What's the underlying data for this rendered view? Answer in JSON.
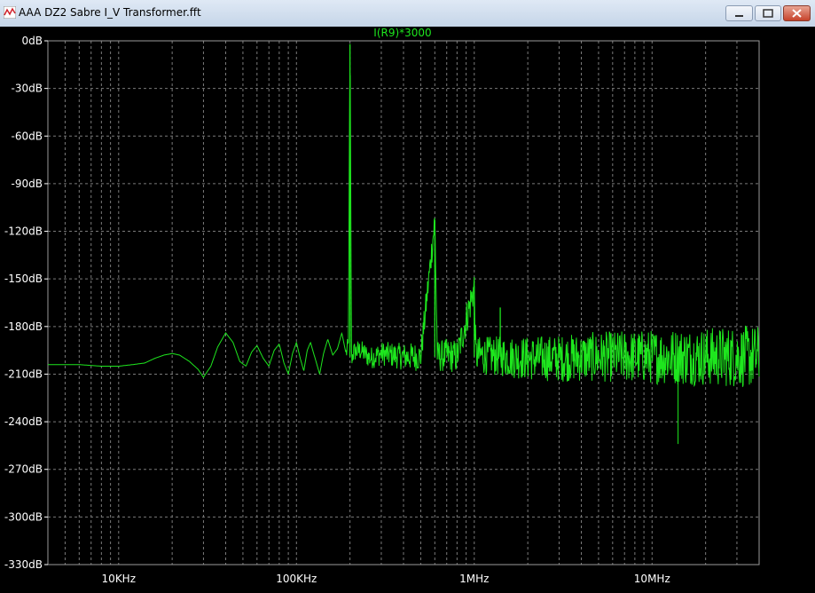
{
  "window": {
    "title": "AAA DZ2 Sabre I_V Transformer.fft",
    "icon": "waveform-icon",
    "controls": [
      "minimize-icon",
      "maximize-icon",
      "close-icon"
    ]
  },
  "colors": {
    "background": "#000000",
    "grid": "#7a7a7a",
    "trace": "#1ee61e",
    "axis_text": "#ffffff",
    "titlebar": "#c5d5e8"
  },
  "chart_data": {
    "type": "line",
    "title": "I(R9)*3000",
    "xscale": "log",
    "x_unit": "Hz",
    "xlim": [
      4000,
      40000000
    ],
    "ylim": [
      -330,
      0
    ],
    "y_ticks": [
      0,
      -30,
      -60,
      -90,
      -120,
      -150,
      -180,
      -210,
      -240,
      -270,
      -300,
      -330
    ],
    "y_tick_labels": [
      "0dB",
      "-30dB",
      "-60dB",
      "-90dB",
      "-120dB",
      "-150dB",
      "-180dB",
      "-210dB",
      "-240dB",
      "-270dB",
      "-300dB",
      "-330dB"
    ],
    "x_ticks": [
      10000,
      100000,
      1000000,
      10000000
    ],
    "x_tick_labels": [
      "10KHz",
      "100KHz",
      "1MHz",
      "10MHz"
    ],
    "grid": true,
    "series": [
      {
        "name": "I(R9)*3000",
        "peaks": [
          {
            "x": 200000,
            "y": -2
          },
          {
            "x": 600000,
            "y": -113
          },
          {
            "x": 1000000,
            "y": -155
          },
          {
            "x": 1400000,
            "y": -168
          }
        ],
        "points": [
          [
            4000,
            -204
          ],
          [
            6000,
            -204
          ],
          [
            8000,
            -205
          ],
          [
            10000,
            -205
          ],
          [
            12000,
            -204
          ],
          [
            14000,
            -203
          ],
          [
            16000,
            -200
          ],
          [
            18000,
            -198
          ],
          [
            20000,
            -197
          ],
          [
            22000,
            -198
          ],
          [
            25000,
            -202
          ],
          [
            28000,
            -207
          ],
          [
            30000,
            -212
          ],
          [
            33000,
            -205
          ],
          [
            36000,
            -193
          ],
          [
            40000,
            -184
          ],
          [
            44000,
            -190
          ],
          [
            48000,
            -202
          ],
          [
            52000,
            -205
          ],
          [
            56000,
            -196
          ],
          [
            60000,
            -192
          ],
          [
            65000,
            -200
          ],
          [
            70000,
            -205
          ],
          [
            75000,
            -195
          ],
          [
            80000,
            -191
          ],
          [
            85000,
            -203
          ],
          [
            90000,
            -210
          ],
          [
            95000,
            -197
          ],
          [
            100000,
            -190
          ],
          [
            105000,
            -200
          ],
          [
            110000,
            -208
          ],
          [
            115000,
            -195
          ],
          [
            120000,
            -190
          ],
          [
            128000,
            -201
          ],
          [
            135000,
            -210
          ],
          [
            142000,
            -197
          ],
          [
            150000,
            -188
          ],
          [
            160000,
            -198
          ],
          [
            170000,
            -194
          ],
          [
            180000,
            -184
          ],
          [
            190000,
            -197
          ],
          [
            196000,
            -192
          ],
          [
            200000,
            -2
          ],
          [
            204000,
            -200
          ],
          [
            210000,
            -196
          ],
          [
            230000,
            -195
          ],
          [
            260000,
            -200
          ],
          [
            300000,
            -197
          ],
          [
            350000,
            -198
          ],
          [
            400000,
            -199
          ],
          [
            500000,
            -199
          ],
          [
            600000,
            -113
          ],
          [
            620000,
            -199
          ],
          [
            700000,
            -198
          ],
          [
            800000,
            -199
          ],
          [
            1000000,
            -155
          ],
          [
            1020000,
            -198
          ],
          [
            1500000,
            -199
          ],
          [
            2000000,
            -200
          ],
          [
            3000000,
            -200
          ],
          [
            5000000,
            -199
          ],
          [
            10000000,
            -199
          ],
          [
            20000000,
            -199
          ],
          [
            40000000,
            -199
          ]
        ]
      }
    ]
  }
}
